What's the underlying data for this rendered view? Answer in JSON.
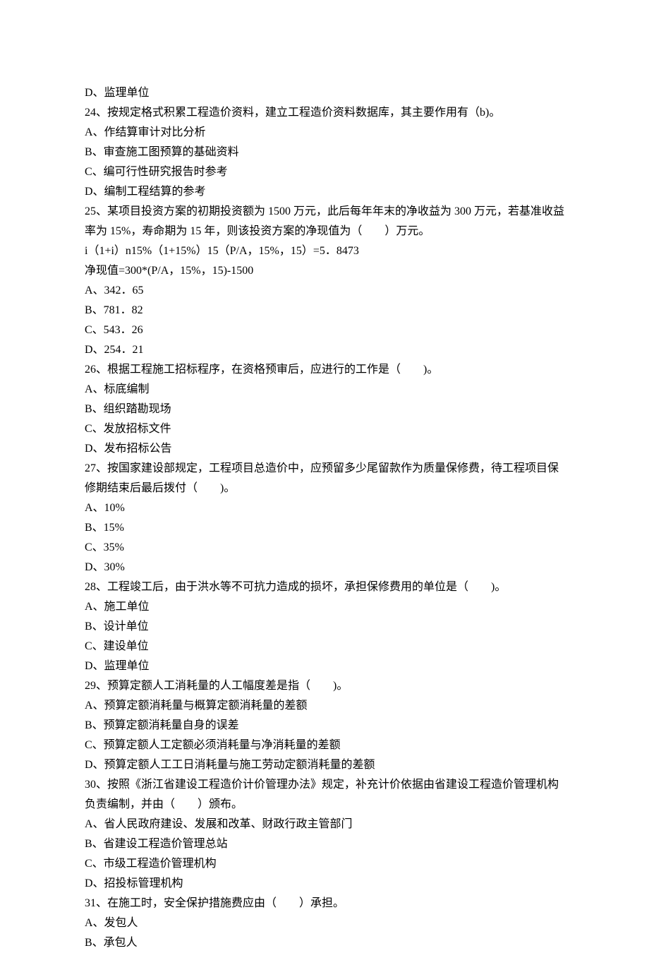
{
  "lines": [
    "D、监理单位",
    "24、按规定格式积累工程造价资料，建立工程造价资料数据库，其主要作用有（b)。",
    "A、作结算审计对比分析",
    "B、审查施工图预算的基础资料",
    "C、编可行性研究报告时参考",
    "D、编制工程结算的参考",
    "25、某项目投资方案的初期投资额为 1500 万元，此后每年年末的净收益为 300 万元，若基准收益率为 15%，寿命期为 15 年，则该投资方案的净现值为（　　）万元。",
    "i（1+i）n15%（1+15%）15（P/A，15%，15）=5．8473",
    "净现值=300*(P/A，15%，15)-1500",
    "A、342．65",
    "B、781．82",
    "C、543．26",
    "D、254．21",
    "26、根据工程施工招标程序，在资格预审后，应进行的工作是（　　)。",
    "A、标底编制",
    "B、组织踏勘现场",
    "C、发放招标文件",
    "D、发布招标公告",
    "27、按国家建设部规定，工程项目总造价中，应预留多少尾留款作为质量保修费，待工程项目保修期结束后最后拨付（　　)。",
    "A、10%",
    "B、15%",
    "C、35%",
    "D、30%",
    "28、工程竣工后，由于洪水等不可抗力造成的损坏，承担保修费用的单位是（　　)。",
    "A、施工单位",
    "B、设计单位",
    "C、建设单位",
    "D、监理单位",
    "29、预算定额人工消耗量的人工幅度差是指（　　)。",
    "A、预算定额消耗量与概算定额消耗量的差额",
    "B、预算定额消耗量自身的误差",
    "C、预算定额人工定额必须消耗量与净消耗量的差额",
    "D、预算定额人工工日消耗量与施工劳动定额消耗量的差额",
    "30、按照《浙江省建设工程造价计价管理办法》规定，补充计价依据由省建设工程造价管理机构负责编制，并由（　　）颁布。",
    "A、省人民政府建设、发展和改革、财政行政主管部门",
    "B、省建设工程造价管理总站",
    "C、市级工程造价管理机构",
    "D、招投标管理机构",
    "31、在施工时，安全保护措施费应由（　　）承担。",
    "A、发包人",
    "B、承包人"
  ]
}
